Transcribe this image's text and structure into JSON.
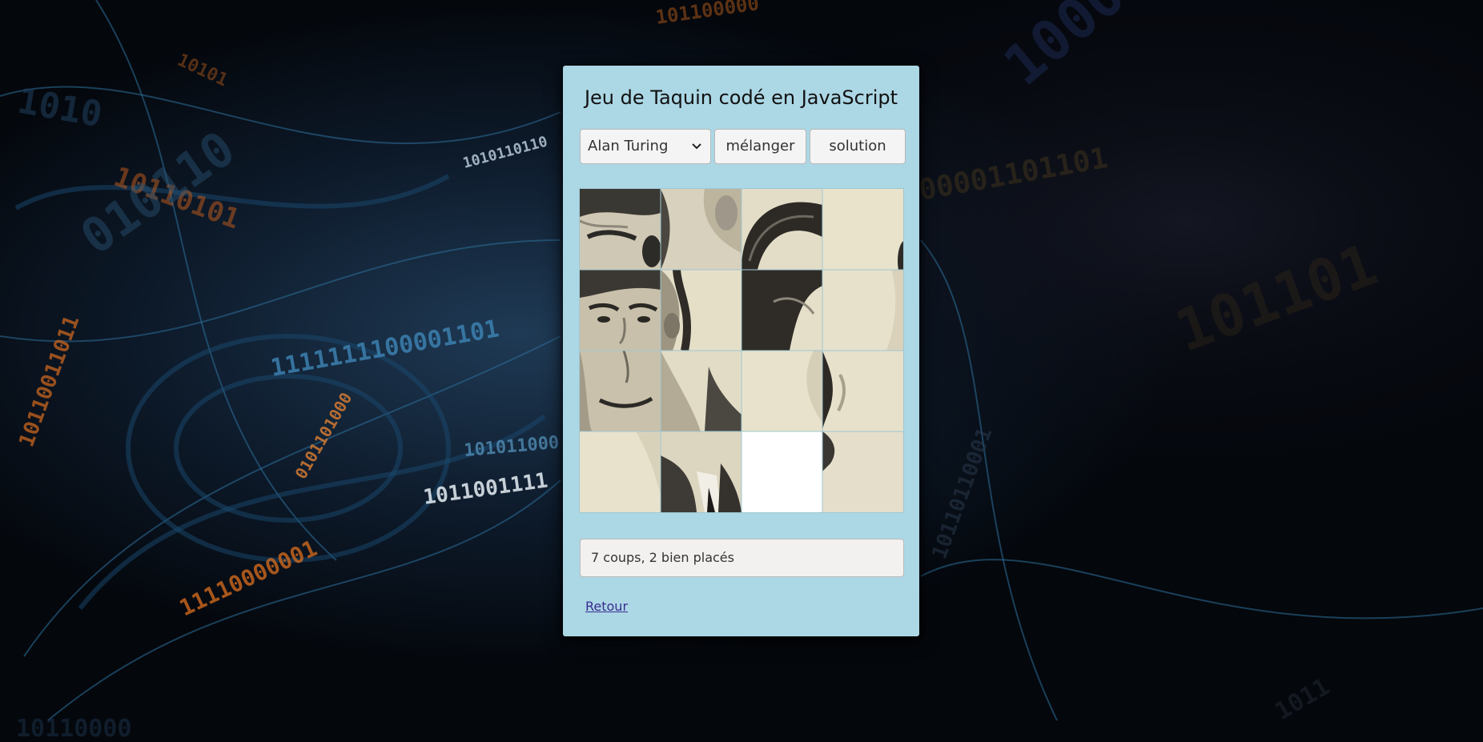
{
  "page": {
    "title": "Jeu de Taquin codé en JavaScript"
  },
  "controls": {
    "image_select": {
      "selected": "Alan Turing",
      "icon": "chevron-down-icon"
    },
    "shuffle_label": "mélanger",
    "solution_label": "solution"
  },
  "board": {
    "rows": 4,
    "cols": 4,
    "empty_tile": {
      "row": 3,
      "col": 2
    }
  },
  "status": {
    "text": "7 coups, 2 bien placés"
  },
  "footer": {
    "back_label": "Retour"
  },
  "colors": {
    "panel_bg": "#acd7e5",
    "link": "#3a2d8f",
    "photo_paper": "#e9e3cc"
  }
}
